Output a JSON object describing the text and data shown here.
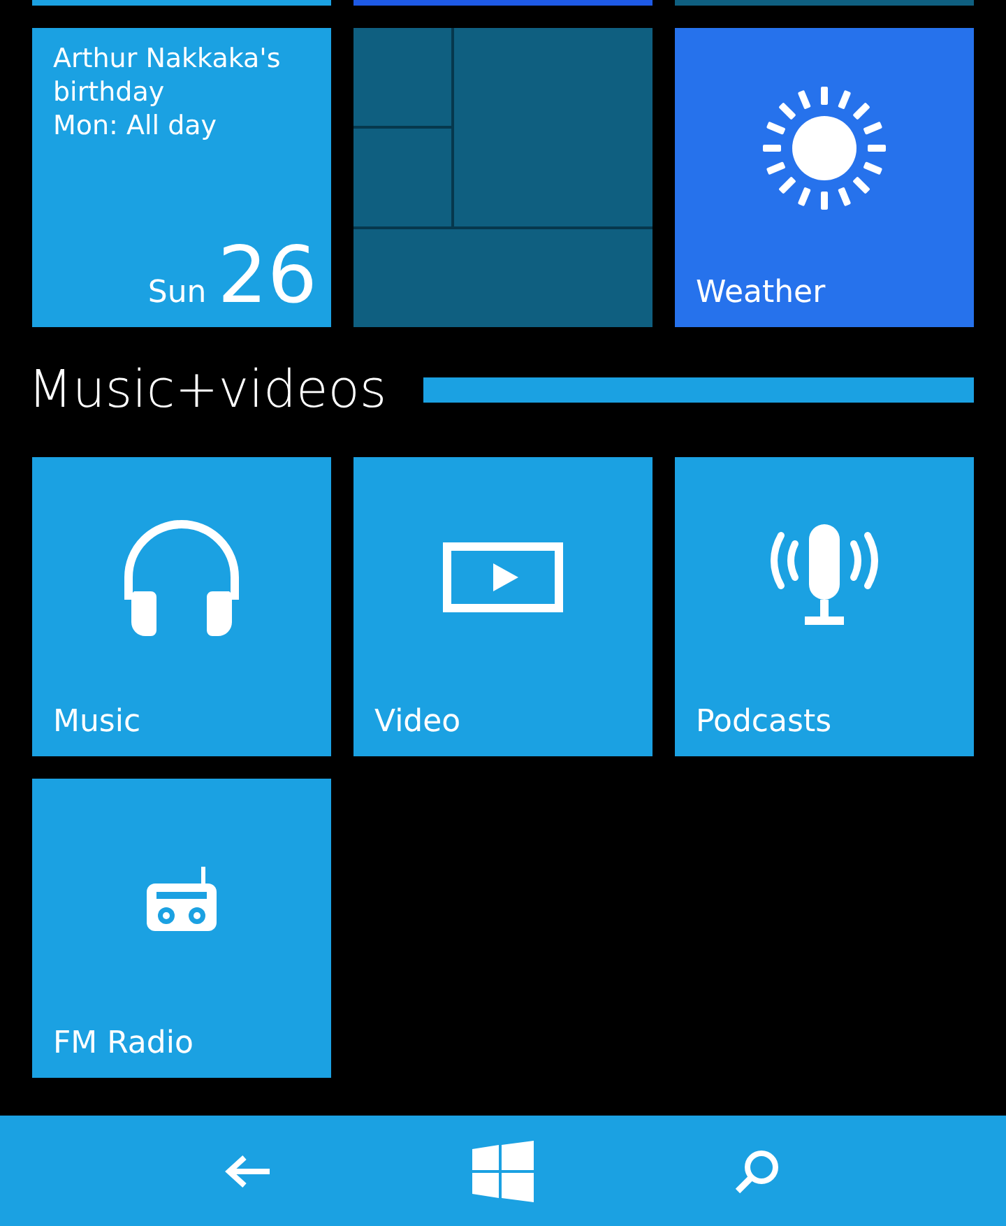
{
  "top_row": [
    {
      "color": "#1ba1e2"
    },
    {
      "color": "#1e5ae6"
    },
    {
      "color": "#0f5f80"
    }
  ],
  "tiles_top": [
    {
      "kind": "calendar",
      "color": "#1ba1e2",
      "event": "Arthur Nakkaka's birthday",
      "when": "Mon: All day",
      "day": "Sun",
      "date": "26"
    },
    {
      "kind": "grid",
      "color": "#0f5f80"
    },
    {
      "kind": "weather",
      "color": "#2672ec",
      "label": "Weather"
    }
  ],
  "section": {
    "title": "Music+videos"
  },
  "tiles": [
    {
      "kind": "music",
      "color": "#1ba1e2",
      "label": "Music"
    },
    {
      "kind": "video",
      "color": "#1ba1e2",
      "label": "Video"
    },
    {
      "kind": "podcasts",
      "color": "#1ba1e2",
      "label": "Podcasts"
    },
    {
      "kind": "radio",
      "color": "#1ba1e2",
      "label": "FM Radio"
    }
  ],
  "nav_bar": {
    "buttons": [
      {
        "kind": "back"
      },
      {
        "kind": "start"
      },
      {
        "kind": "search"
      }
    ]
  }
}
